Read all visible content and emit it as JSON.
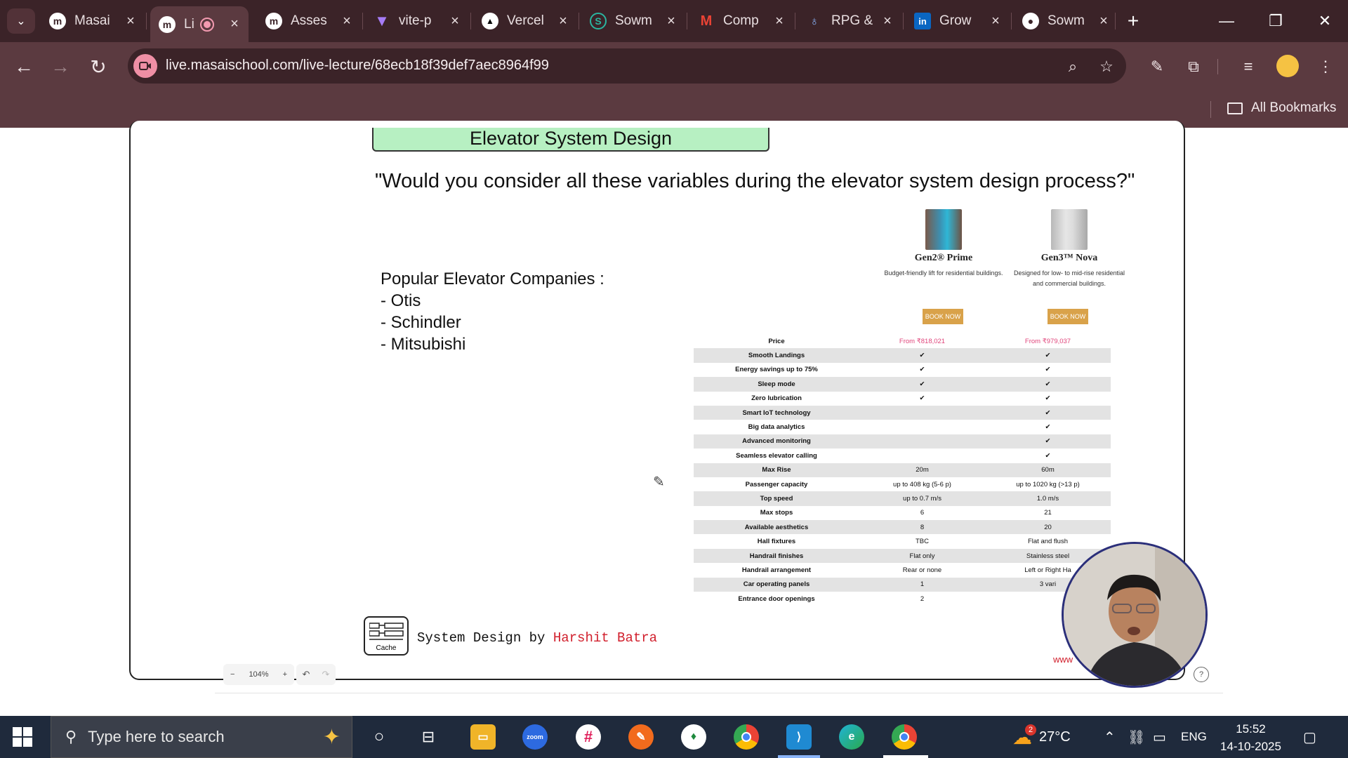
{
  "browser": {
    "tabs": [
      {
        "title": "Masai",
        "favicon": "masai-icon",
        "active": false
      },
      {
        "title": "Li",
        "favicon": "masai-icon",
        "active": true,
        "recording": true
      },
      {
        "title": "Asses",
        "favicon": "masai-icon",
        "active": false
      },
      {
        "title": "vite-p",
        "favicon": "vite-icon",
        "active": false
      },
      {
        "title": "Vercel",
        "favicon": "vercel-icon",
        "active": false
      },
      {
        "title": "Sowm",
        "favicon": "s-icon",
        "active": false
      },
      {
        "title": "Comp",
        "favicon": "gmail-icon",
        "active": false
      },
      {
        "title": "RPG &",
        "favicon": "rpg-icon",
        "active": false
      },
      {
        "title": "Grow",
        "favicon": "linkedin-icon",
        "active": false
      },
      {
        "title": "Sowm",
        "favicon": "github-icon",
        "active": false
      }
    ],
    "url": "live.masaischool.com/live-lecture/68ecb18f39def7aec8964f99",
    "bookmarks_label": "All Bookmarks"
  },
  "slide": {
    "title": "Elevator System Design",
    "question": "\"Would you consider all these variables during the elevator system design process?\"",
    "companies_heading": "Popular Elevator Companies :",
    "companies": [
      "- Otis",
      "- Schindler",
      "- Mitsubishi"
    ],
    "products": [
      {
        "name": "Gen2® Prime",
        "desc": "Budget-friendly lift for residential buildings.",
        "cta": "BOOK NOW"
      },
      {
        "name": "Gen3™ Nova",
        "desc": "Designed for low- to mid-rise residential and commercial buildings.",
        "cta": "BOOK NOW"
      }
    ],
    "spec_rows": [
      [
        "Price",
        "From ₹818,021",
        "From ₹979,037"
      ],
      [
        "Smooth Landings",
        "✔",
        "✔"
      ],
      [
        "Energy savings up to 75%",
        "✔",
        "✔"
      ],
      [
        "Sleep mode",
        "✔",
        "✔"
      ],
      [
        "Zero lubrication",
        "✔",
        "✔"
      ],
      [
        "Smart IoT technology",
        "",
        "✔"
      ],
      [
        "Big data analytics",
        "",
        "✔"
      ],
      [
        "Advanced monitoring",
        "",
        "✔"
      ],
      [
        "Seamless elevator calling",
        "",
        "✔"
      ],
      [
        "Max Rise",
        "20m",
        "60m"
      ],
      [
        "Passenger capacity",
        "up to 408 kg (5-6 p)",
        "up to 1020 kg (>13 p)"
      ],
      [
        "Top speed",
        "up to 0.7 m/s",
        "1.0 m/s"
      ],
      [
        "Max stops",
        "6",
        "21"
      ],
      [
        "Available aesthetics",
        "8",
        "20"
      ],
      [
        "Hall fixtures",
        "TBC",
        "Flat and flush"
      ],
      [
        "Handrail finishes",
        "Flat only",
        "Stainless steel"
      ],
      [
        "Handrail arrangement",
        "Rear or none",
        "Left or Right Ha"
      ],
      [
        "Car operating panels",
        "1",
        "3 vari"
      ],
      [
        "Entrance door openings",
        "2",
        ""
      ]
    ],
    "footer_prefix": "System Design by ",
    "footer_author": "Harshit Batra",
    "logo_caption": "Cache",
    "website_partial": "www"
  },
  "board_controls": {
    "zoom_out": "−",
    "zoom_level": "104%",
    "zoom_in": "+",
    "undo": "↶",
    "redo": "↷",
    "help": "?"
  },
  "taskbar": {
    "search_placeholder": "Type here to search",
    "weather": "27°C",
    "weather_badge": "2",
    "language": "ENG",
    "time": "15:52",
    "date": "14-10-2025"
  },
  "colors": {
    "chrome_dark": "#3b2328",
    "chrome_toolbar": "#5b3a40",
    "title_green": "#b7f0c2",
    "author_red": "#d11f2c",
    "price_pink": "#e0457b",
    "book_btn": "#d9a24a",
    "taskbar": "#1f2a3c"
  }
}
